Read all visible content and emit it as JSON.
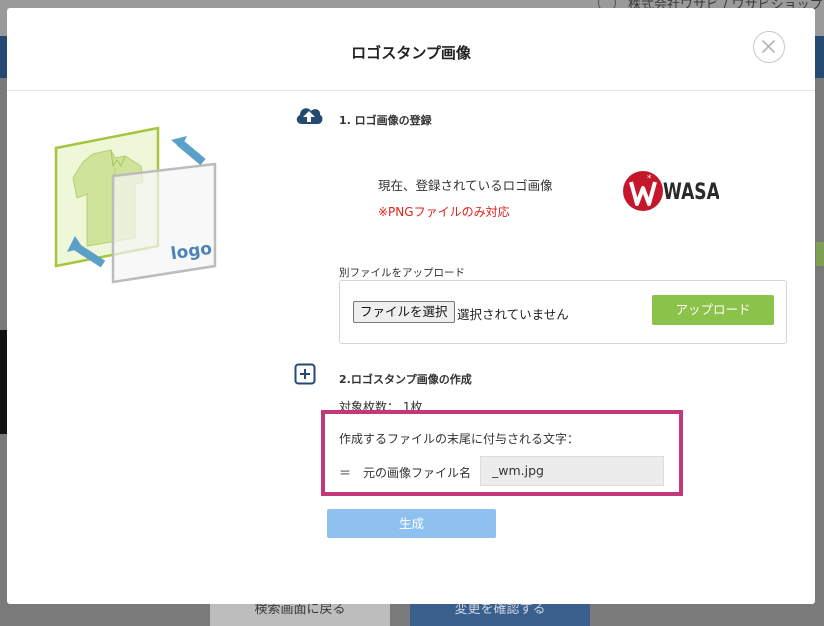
{
  "background": {
    "company_name": "株式会社ワサビ / ワサビショップ",
    "back_button": "検索画面に戻る",
    "confirm_button": "変更を確認する"
  },
  "modal": {
    "title": "ロゴスタンプ画像",
    "illustration": {
      "logo_text": "logo"
    },
    "section1": {
      "title": "1. ロゴ画像の登録",
      "current_label": "現在、登録されているロゴ画像",
      "png_note": "※PNGファイルのみ対応",
      "current_logo_text": "WASABI",
      "upload_label": "別ファイルをアップロード",
      "file_button": "ファイルを選択",
      "file_status": "選択されていません",
      "upload_button": "アップロード"
    },
    "section2": {
      "title": "2.ロゴスタンプ画像の作成",
      "count_line": "対象枚数： 1枚",
      "suffix_label": "作成するファイルの末尾に付与される文字：",
      "suffix_eq": "＝",
      "suffix_prefix": "元の画像ファイル名",
      "suffix_value": "_wm.jpg",
      "generate_button": "生成"
    }
  },
  "colors": {
    "accent_blue": "#244a72",
    "upload_green": "#8bc34a",
    "generate_blue": "#8ec1ef",
    "highlight_magenta": "#c2397a",
    "note_red": "#e2231a"
  }
}
